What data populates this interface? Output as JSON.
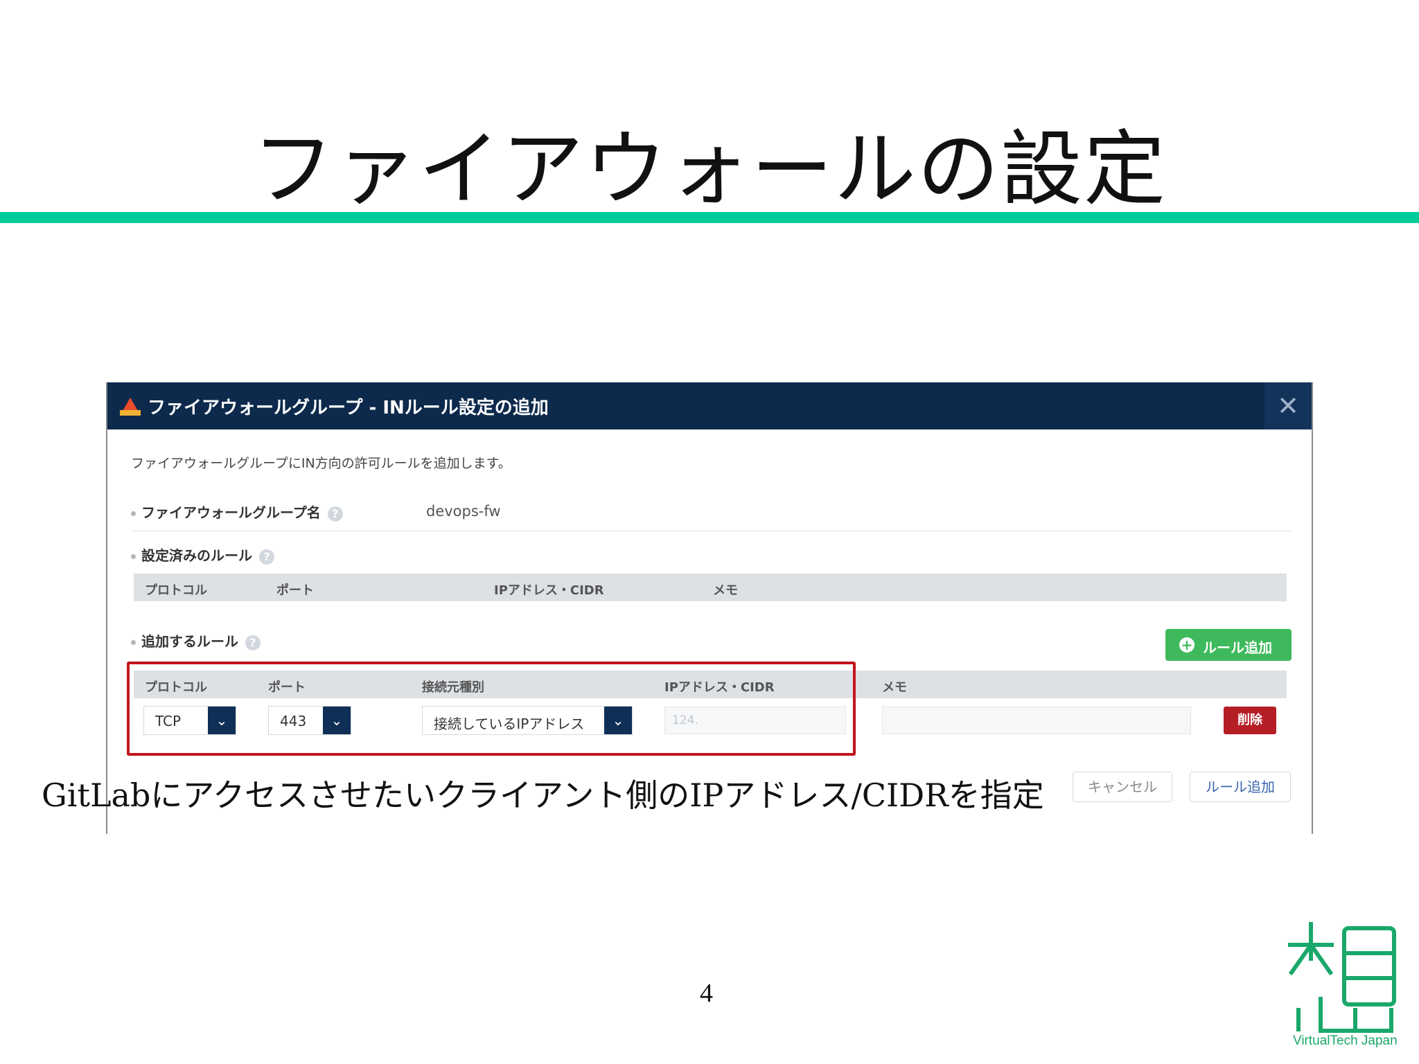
{
  "slide": {
    "title": "ファイアウォールの設定",
    "page_number": "4",
    "annotation": "GitLabにアクセスさせたいクライアント側のIPアドレス/CIDRを指定",
    "logo_text": "VirtualTech Japan"
  },
  "dialog": {
    "title": "ファイアウォールグループ - INルール設定の追加",
    "close_label": "✕",
    "description": "ファイアウォールグループにIN方向の許可ルールを追加します。",
    "group_name_label": "ファイアウォールグループ名",
    "group_name_value": "devops-fw",
    "existing_rules_label": "設定済みのルール",
    "existing_rules_columns": [
      "プロトコル",
      "ポート",
      "IPアドレス・CIDR",
      "メモ"
    ],
    "add_rules_label": "追加するルール",
    "add_rule_button": "ルール追加",
    "new_rule_columns": [
      "プロトコル",
      "ポート",
      "接続元種別",
      "IPアドレス・CIDR",
      "メモ"
    ],
    "new_rule": {
      "protocol": "TCP",
      "port": "443",
      "source_type": "接続しているIPアドレス",
      "ip_placeholder": "124.",
      "memo": ""
    },
    "delete_button": "削除",
    "cancel_button": "キャンセル",
    "submit_button": "ルール追加",
    "help_glyph": "?",
    "dropdown_glyph": "⌄",
    "plus_glyph": "+"
  },
  "colors": {
    "accent_rule": "#00cc99",
    "header_bg": "#0d2a4c",
    "add_button": "#3eba5c",
    "delete_button": "#b51e25",
    "highlight_border": "#c2151d"
  }
}
